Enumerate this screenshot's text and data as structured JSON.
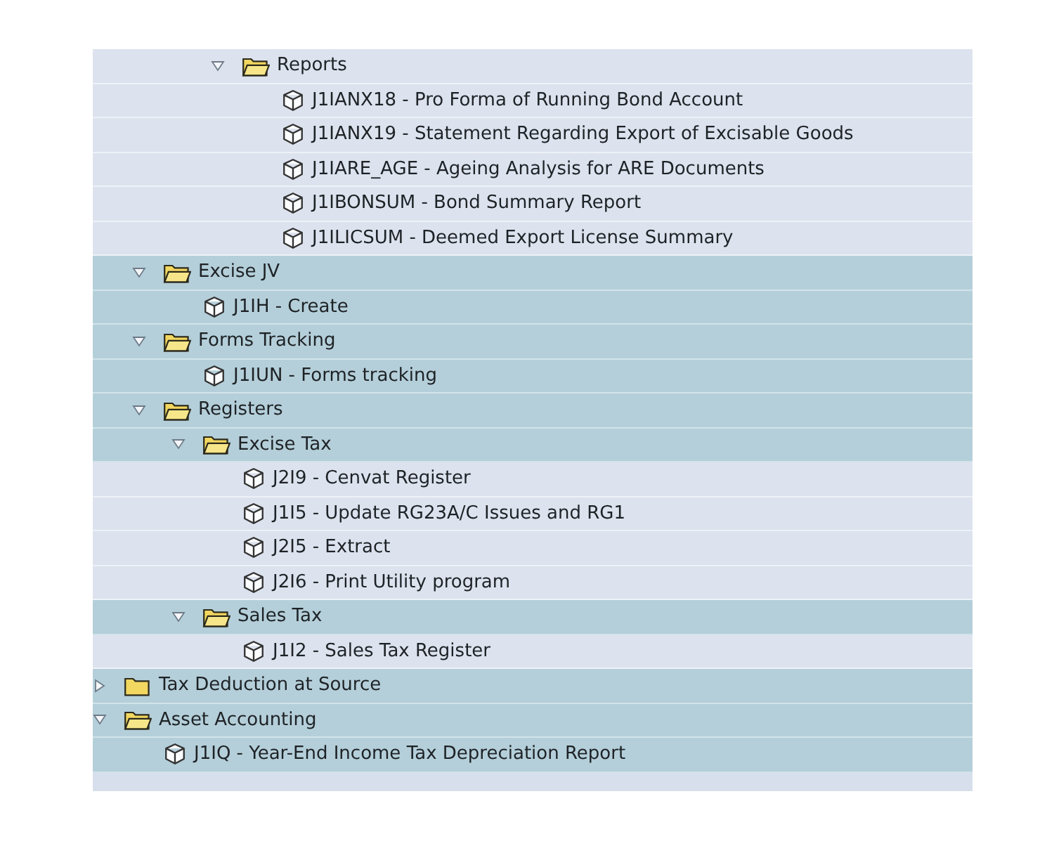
{
  "tree": [
    {
      "children": [
        {
          "children": [
            {
              "children": [
                {
                  "kind": "folder",
                  "label": "Reports",
                  "expanded": true,
                  "shaded": false,
                  "children": [
                    {
                      "kind": "transaction",
                      "label": "J1IANX18 - Pro Forma of Running Bond Account",
                      "shaded": false
                    },
                    {
                      "kind": "transaction",
                      "label": "J1IANX19 - Statement Regarding Export of Excisable Goods",
                      "shaded": false
                    },
                    {
                      "kind": "transaction",
                      "label": "J1IARE_AGE - Ageing Analysis for ARE Documents",
                      "shaded": false
                    },
                    {
                      "kind": "transaction",
                      "label": "J1IBONSUM - Bond Summary Report",
                      "shaded": false
                    },
                    {
                      "kind": "transaction",
                      "label": "J1ILICSUM - Deemed Export License Summary",
                      "shaded": false
                    }
                  ]
                }
              ]
            }
          ]
        },
        {
          "kind": "folder",
          "label": "Excise JV",
          "expanded": true,
          "shaded": true,
          "children": [
            {
              "kind": "transaction",
              "label": "J1IH - Create",
              "shaded": true
            }
          ]
        },
        {
          "kind": "folder",
          "label": "Forms Tracking",
          "expanded": true,
          "shaded": true,
          "children": [
            {
              "kind": "transaction",
              "label": "J1IUN - Forms tracking",
              "shaded": true
            }
          ]
        },
        {
          "kind": "folder",
          "label": "Registers",
          "expanded": true,
          "shaded": true,
          "children": [
            {
              "kind": "folder",
              "label": "Excise Tax",
              "expanded": true,
              "shaded": true,
              "children": [
                {
                  "kind": "transaction",
                  "label": "J2I9 - Cenvat Register",
                  "shaded": false
                },
                {
                  "kind": "transaction",
                  "label": "J1I5 - Update RG23A/C Issues and RG1",
                  "shaded": false
                },
                {
                  "kind": "transaction",
                  "label": "J2I5 - Extract",
                  "shaded": false
                },
                {
                  "kind": "transaction",
                  "label": "J2I6 - Print Utility program",
                  "shaded": false
                }
              ]
            },
            {
              "kind": "folder",
              "label": "Sales Tax",
              "expanded": true,
              "shaded": true,
              "children": [
                {
                  "kind": "transaction",
                  "label": "J1I2 - Sales Tax Register",
                  "shaded": false
                }
              ]
            }
          ]
        }
      ]
    },
    {
      "kind": "folder",
      "label": "Tax Deduction at Source",
      "expanded": false,
      "shaded": true
    },
    {
      "kind": "folder",
      "label": "Asset Accounting",
      "expanded": true,
      "shaded": true,
      "children": [
        {
          "kind": "transaction",
          "label": "J1IQ - Year-End Income Tax Depreciation Report",
          "shaded": true
        }
      ]
    }
  ]
}
